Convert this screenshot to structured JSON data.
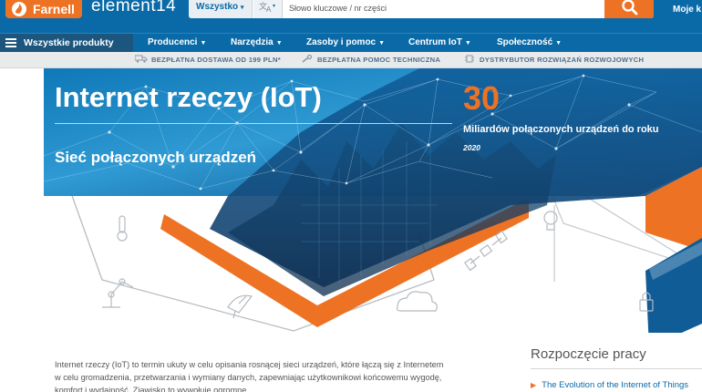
{
  "header": {
    "farnell_logo": "Farnell",
    "element14_logo": "element14",
    "search": {
      "category": "Wszystko",
      "language_icon": "translate-icon",
      "placeholder": "Słowo kluczowe / nr części",
      "value": ""
    },
    "account_link": "Moje k"
  },
  "nav": {
    "all_products": "Wszystkie produkty",
    "items": [
      "Producenci",
      "Narzędzia",
      "Zasoby i pomoc",
      "Centrum IoT",
      "Społeczność"
    ]
  },
  "benefits": [
    {
      "label": "BEZPŁATNA DOSTAWA OD 199 PLN*",
      "icon": "truck-icon"
    },
    {
      "label": "BEZPŁATNA POMOC TECHNICZNA",
      "icon": "wrench-icon"
    },
    {
      "label": "DYSTRYBUTOR ROZWIĄZAŃ ROZWOJOWYCH",
      "icon": "chip-icon"
    }
  ],
  "hero": {
    "title": "Internet rzeczy (IoT)",
    "subtitle": "Sieć połączonych urządzeń",
    "stat_number": "30",
    "stat_text": "Miliardów połączonych urządzeń do roku",
    "stat_year": "2020"
  },
  "intro": {
    "text": "Internet rzeczy (IoT) to termin ukuty w celu opisania rosnącej sieci urządzeń, które łączą się z Internetem w celu gromadzenia, przetwarzania i wymiany danych, zapewniając użytkownikowi końcowemu wygodę, komfort i wydajność. Zjawisko to wywołuje ogromne"
  },
  "sidebar": {
    "title": "Rozpoczęcie pracy",
    "links": [
      "The Evolution of the Internet of Things"
    ]
  },
  "colors": {
    "brand_blue": "#0a6aa8",
    "accent_orange": "#ee7223",
    "nav_dark": "#1c567f",
    "strip_bg": "#e9eaeb"
  }
}
